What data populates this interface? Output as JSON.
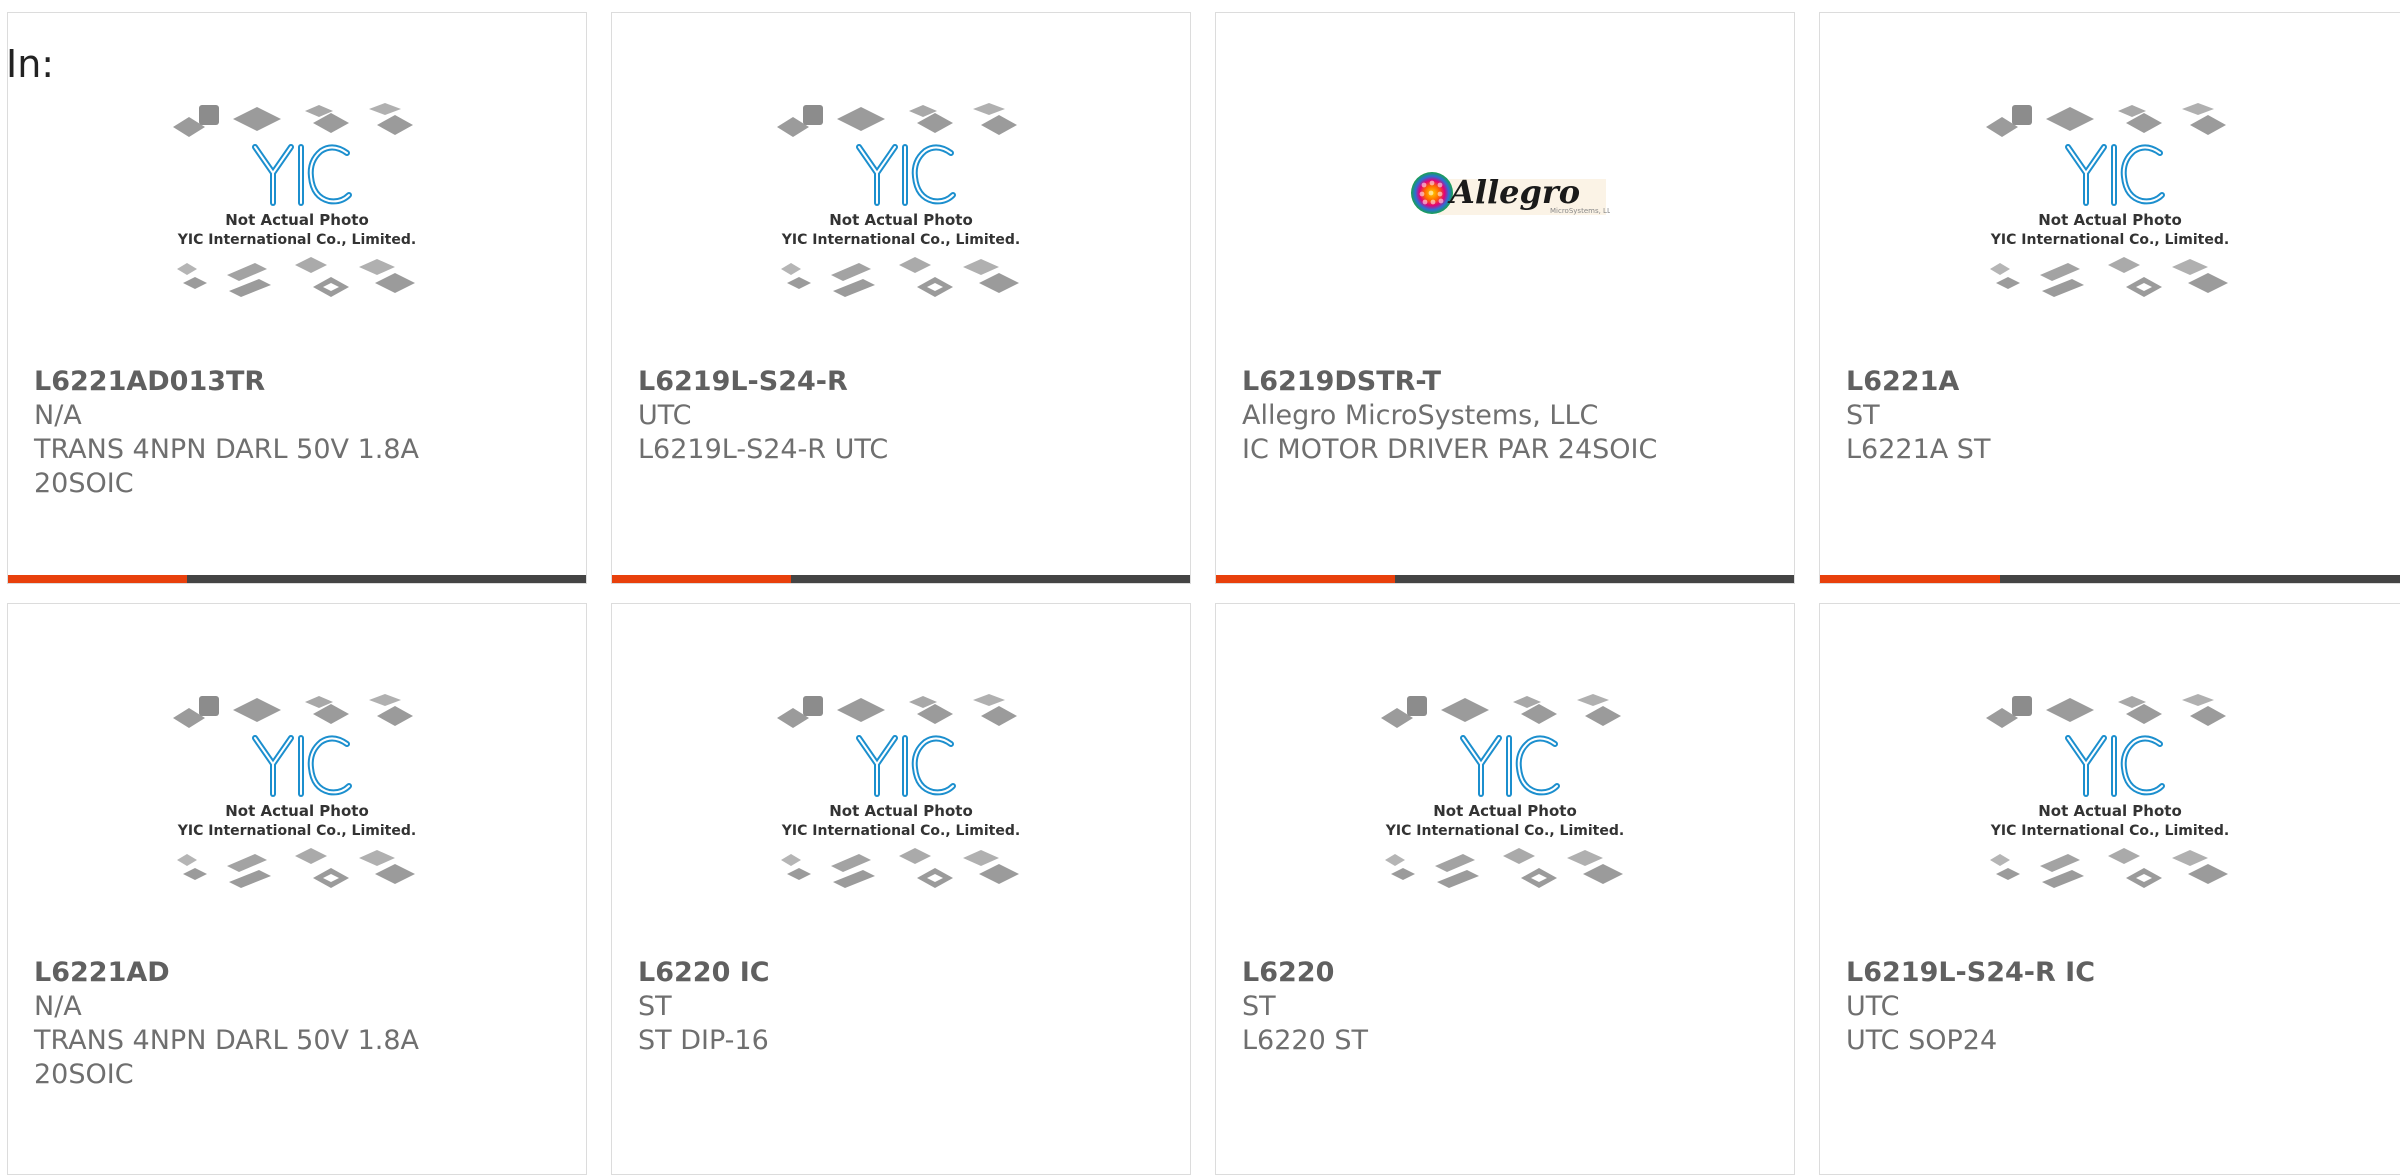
{
  "header": {
    "in_label": "In:"
  },
  "placeholder": {
    "line1": "Not Actual Photo",
    "line2": "YIC International Co., Limited.",
    "logo": "YIC"
  },
  "brand_logo": {
    "text": "Allegro",
    "subtext": "MicroSystems, LLC"
  },
  "colors": {
    "accent": "#e8400c",
    "bar": "#444444",
    "yic_blue": "#1c8fce",
    "text": "#6f6f6f"
  },
  "bar_progress": 0.31,
  "products": [
    {
      "title": "L6221AD013TR",
      "brand": "N/A",
      "desc1": "TRANS 4NPN DARL 50V 1.8A",
      "desc2": "20SOIC",
      "image": "yic-placeholder"
    },
    {
      "title": "L6219L-S24-R",
      "brand": "UTC",
      "desc1": "L6219L-S24-R UTC",
      "desc2": "",
      "image": "yic-placeholder"
    },
    {
      "title": "L6219DSTR-T",
      "brand": "Allegro MicroSystems, LLC",
      "desc1": "IC MOTOR DRIVER PAR 24SOIC",
      "desc2": "",
      "image": "allegro-logo"
    },
    {
      "title": "L6221A",
      "brand": "ST",
      "desc1": "L6221A ST",
      "desc2": "",
      "image": "yic-placeholder"
    },
    {
      "title": "L6221AD",
      "brand": "N/A",
      "desc1": "TRANS 4NPN DARL 50V 1.8A",
      "desc2": "20SOIC",
      "image": "yic-placeholder"
    },
    {
      "title": "L6220 IC",
      "brand": "ST",
      "desc1": "ST DIP-16",
      "desc2": "",
      "image": "yic-placeholder"
    },
    {
      "title": "L6220",
      "brand": "ST",
      "desc1": "L6220 ST",
      "desc2": "",
      "image": "yic-placeholder"
    },
    {
      "title": "L6219L-S24-R IC",
      "brand": "UTC",
      "desc1": "UTC SOP24",
      "desc2": "",
      "image": "yic-placeholder"
    }
  ]
}
